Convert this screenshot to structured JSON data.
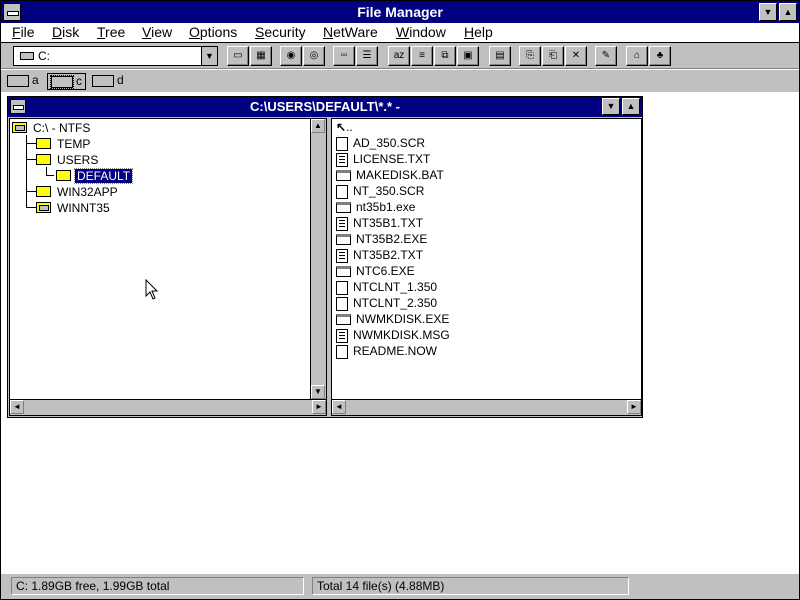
{
  "window": {
    "title": "File Manager"
  },
  "menu": {
    "items": [
      {
        "ul": "F",
        "rest": "ile"
      },
      {
        "ul": "D",
        "rest": "isk"
      },
      {
        "ul": "T",
        "rest": "ree"
      },
      {
        "ul": "V",
        "rest": "iew"
      },
      {
        "ul": "O",
        "rest": "ptions"
      },
      {
        "ul": "S",
        "rest": "ecurity"
      },
      {
        "ul": "N",
        "rest": "etWare"
      },
      {
        "ul": "W",
        "rest": "indow"
      },
      {
        "ul": "H",
        "rest": "elp"
      }
    ]
  },
  "toolbar": {
    "drive_value": "C:"
  },
  "drives": [
    {
      "letter": "a"
    },
    {
      "letter": "c"
    },
    {
      "letter": "d"
    }
  ],
  "child": {
    "title": "C:\\USERS\\DEFAULT\\*.* -"
  },
  "tree": {
    "root": "C:\\ - NTFS",
    "items": [
      {
        "label": "TEMP"
      },
      {
        "label": "USERS"
      },
      {
        "label": "DEFAULT"
      },
      {
        "label": "WIN32APP"
      },
      {
        "label": "WINNT35"
      }
    ]
  },
  "files": {
    "up": "..",
    "items": [
      {
        "name": "AD_350.SCR",
        "type": "file"
      },
      {
        "name": "LICENSE.TXT",
        "type": "doc"
      },
      {
        "name": "MAKEDISK.BAT",
        "type": "exe"
      },
      {
        "name": "NT_350.SCR",
        "type": "file"
      },
      {
        "name": "nt35b1.exe",
        "type": "exe"
      },
      {
        "name": "NT35B1.TXT",
        "type": "doc"
      },
      {
        "name": "NT35B2.EXE",
        "type": "exe"
      },
      {
        "name": "NT35B2.TXT",
        "type": "doc"
      },
      {
        "name": "NTC6.EXE",
        "type": "exe"
      },
      {
        "name": "NTCLNT_1.350",
        "type": "file"
      },
      {
        "name": "NTCLNT_2.350",
        "type": "file"
      },
      {
        "name": "NWMKDISK.EXE",
        "type": "exe"
      },
      {
        "name": "NWMKDISK.MSG",
        "type": "doc"
      },
      {
        "name": "README.NOW",
        "type": "file"
      }
    ]
  },
  "status": {
    "disk": "C: 1.89GB free,  1.99GB total",
    "total": "Total 14 file(s) (4.88MB)"
  }
}
